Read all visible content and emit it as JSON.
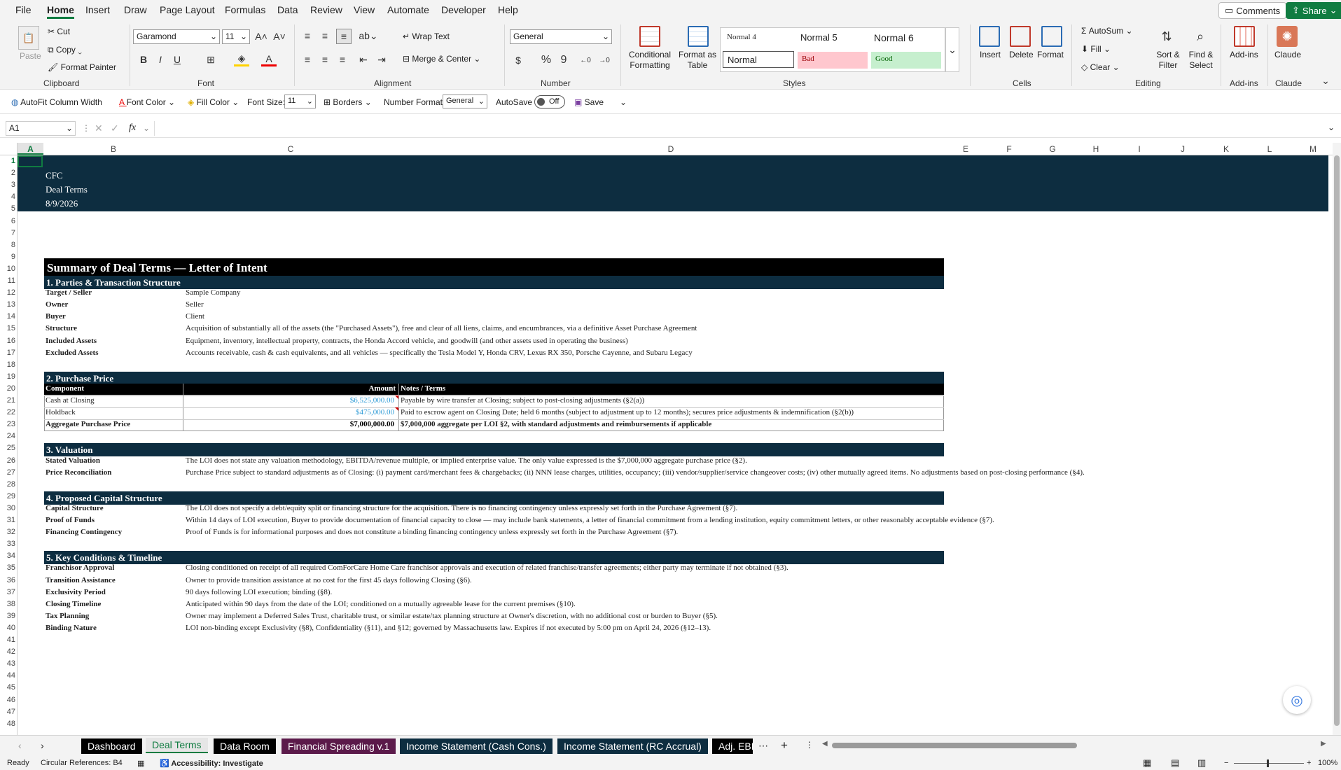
{
  "menu": {
    "items": [
      "File",
      "Home",
      "Insert",
      "Draw",
      "Page Layout",
      "Formulas",
      "Data",
      "Review",
      "View",
      "Automate",
      "Developer",
      "Help"
    ],
    "comments": "Comments",
    "share": "Share"
  },
  "ribbon": {
    "clipboard": {
      "paste": "Paste",
      "cut": "Cut",
      "copy": "Copy",
      "format_painter": "Format Painter",
      "label": "Clipboard"
    },
    "font": {
      "name": "Garamond",
      "size": "11",
      "label": "Font",
      "bold": "B",
      "italic": "I",
      "underline": "U"
    },
    "alignment": {
      "wrap": "Wrap Text",
      "merge": "Merge & Center",
      "label": "Alignment"
    },
    "number": {
      "format": "General",
      "currency": "$",
      "percent": "%",
      "comma": "9",
      "label": "Number"
    },
    "styles": {
      "conditional": "Conditional Formatting",
      "format_table": "Format as Table",
      "normal4": "Normal 4",
      "normal5": "Normal 5",
      "normal6": "Normal 6",
      "normal": "Normal",
      "bad": "Bad",
      "good": "Good",
      "label": "Styles"
    },
    "cells": {
      "insert": "Insert",
      "delete": "Delete",
      "format": "Format",
      "label": "Cells"
    },
    "editing": {
      "autosum": "AutoSum",
      "fill": "Fill",
      "clear": "Clear",
      "sort": "Sort & Filter",
      "find": "Find & Select",
      "label": "Editing"
    },
    "addins": {
      "addins": "Add-ins",
      "label": "Add-ins"
    },
    "claude": {
      "claude": "Claude",
      "label": "Claude"
    }
  },
  "qat": {
    "autofit": "AutoFit Column Width",
    "font_color": "Font Color",
    "fill_color": "Fill Color",
    "font_size_label": "Font Size:",
    "font_size": "11",
    "borders": "Borders",
    "number_format_label": "Number Format",
    "number_format": "General",
    "autosave": "AutoSave",
    "autosave_state": "Off",
    "save": "Save"
  },
  "formula_bar": {
    "name_box": "A1",
    "fx": "fx",
    "value": ""
  },
  "columns": [
    "A",
    "B",
    "C",
    "D",
    "E",
    "F",
    "G",
    "H",
    "I",
    "J",
    "K",
    "L",
    "M"
  ],
  "banner": {
    "company": "CFC",
    "doc": "Deal Terms",
    "date": "8/9/2026"
  },
  "title": "Summary of Deal Terms — Letter of Intent",
  "sections": {
    "s1": {
      "title": "1. Parties & Transaction Structure",
      "rows": [
        {
          "k": "Target / Seller",
          "v": "Sample Company"
        },
        {
          "k": "Owner",
          "v": "Seller"
        },
        {
          "k": "Buyer",
          "v": "Client"
        },
        {
          "k": "Structure",
          "v": "Acquisition of substantially all of the assets (the \"Purchased Assets\"), free and clear of all liens, claims, and encumbrances, via a definitive Asset Purchase Agreement"
        },
        {
          "k": "Included Assets",
          "v": "Equipment, inventory, intellectual property, contracts, the Honda Accord vehicle, and goodwill (and other assets used in operating the business)"
        },
        {
          "k": "Excluded Assets",
          "v": "Accounts receivable, cash & cash equivalents, and all vehicles — specifically the Tesla Model Y, Honda CRV, Lexus RX 350, Porsche Cayenne, and Subaru Legacy"
        }
      ]
    },
    "s2": {
      "title": "2. Purchase Price",
      "headers": [
        "Component",
        "Amount",
        "Notes / Terms"
      ],
      "rows": [
        {
          "c": "Cash at Closing",
          "a": "$6,525,000.00",
          "n": "Payable by wire transfer at Closing; subject to post-closing adjustments (§2(a))"
        },
        {
          "c": "Holdback",
          "a": "$475,000.00",
          "n": "Paid to escrow agent on Closing Date; held 6 months (subject to adjustment up to 12 months); secures price adjustments & indemnification (§2(b))"
        },
        {
          "c": "Aggregate Purchase Price",
          "a": "$7,000,000.00",
          "n": "$7,000,000 aggregate per LOI §2, with standard adjustments and reimbursements if applicable"
        }
      ]
    },
    "s3": {
      "title": "3. Valuation",
      "rows": [
        {
          "k": "Stated Valuation",
          "v": "The LOI does not state any valuation methodology, EBITDA/revenue multiple, or implied enterprise value. The only value expressed is the $7,000,000 aggregate purchase price (§2)."
        },
        {
          "k": "Price Reconciliation",
          "v": "Purchase Price subject to standard adjustments as of Closing: (i) payment card/merchant fees & chargebacks; (ii) NNN lease charges, utilities, occupancy; (iii) vendor/supplier/service changeover costs; (iv) other mutually agreed items. No adjustments based on post-closing performance (§4)."
        }
      ]
    },
    "s4": {
      "title": "4. Proposed Capital Structure",
      "rows": [
        {
          "k": "Capital Structure",
          "v": "The LOI does not specify a debt/equity split or financing structure for the acquisition. There is no financing contingency unless expressly set forth in the Purchase Agreement (§7)."
        },
        {
          "k": "Proof of Funds",
          "v": "Within 14 days of LOI execution, Buyer to provide documentation of financial capacity to close — may include bank statements, a letter of financial commitment from a lending institution, equity commitment letters, or other reasonably acceptable evidence (§7)."
        },
        {
          "k": "Financing Contingency",
          "v": "Proof of Funds is for informational purposes and does not constitute a binding financing contingency unless expressly set forth in the Purchase Agreement (§7)."
        }
      ]
    },
    "s5": {
      "title": "5. Key Conditions & Timeline",
      "rows": [
        {
          "k": "Franchisor Approval",
          "v": "Closing conditioned on receipt of all required ComForCare Home Care franchisor approvals and execution of related franchise/transfer agreements; either party may terminate if not obtained (§3)."
        },
        {
          "k": "Transition Assistance",
          "v": "Owner to provide transition assistance at no cost for the first 45 days following Closing (§6)."
        },
        {
          "k": "Exclusivity Period",
          "v": "90 days following LOI execution; binding (§8)."
        },
        {
          "k": "Closing Timeline",
          "v": "Anticipated within 90 days from the date of the LOI; conditioned on a mutually agreeable lease for the current premises (§10)."
        },
        {
          "k": "Tax Planning",
          "v": "Owner may implement a Deferred Sales Trust, charitable trust, or similar estate/tax planning structure at Owner's discretion, with no additional cost or burden to Buyer (§5)."
        },
        {
          "k": "Binding Nature",
          "v": "LOI non-binding except Exclusivity (§8), Confidentiality (§11), and §12; governed by Massachusetts law. Expires if not executed by 5:00 pm on April 24, 2026 (§12–13)."
        }
      ]
    }
  },
  "tabs": [
    "Dashboard",
    "Deal Terms",
    "Data Room",
    "Financial Spreading v.1",
    "Income Statement (Cash Cons.)",
    "Income Statement (RC Accrual)",
    "Adj. EBI"
  ],
  "tab_colors": {
    "active": "#e6e6e6",
    "dashboard": "#000000",
    "financial": "#5b1a4a",
    "income": "#0d2d40"
  },
  "status": {
    "ready": "Ready",
    "circular": "Circular References: B4",
    "accessibility": "Accessibility: Investigate",
    "zoom": "100%"
  }
}
